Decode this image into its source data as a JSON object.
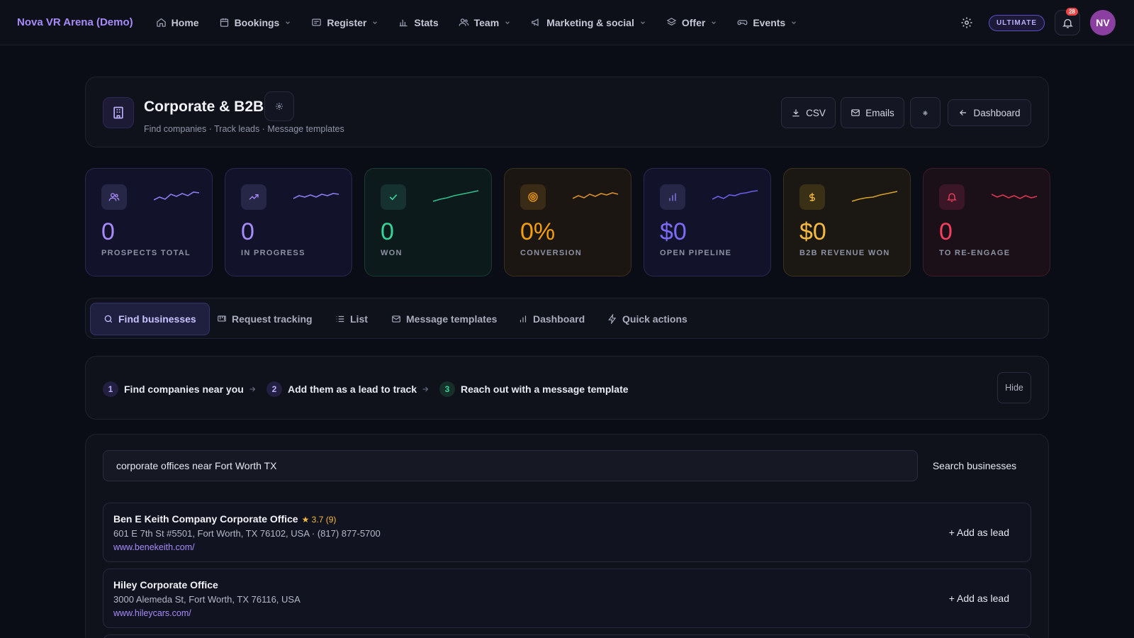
{
  "nav": {
    "brand": "Nova VR Arena (Demo)",
    "items": [
      {
        "label": "Home",
        "icon": "home-icon"
      },
      {
        "label": "Bookings",
        "icon": "calendar-icon"
      },
      {
        "label": "Register",
        "icon": "register-icon"
      },
      {
        "label": "Stats",
        "icon": "bar-chart-icon"
      },
      {
        "label": "Team",
        "icon": "users-icon"
      },
      {
        "label": "Marketing & social",
        "icon": "megaphone-icon"
      },
      {
        "label": "Offer",
        "icon": "layers-icon"
      },
      {
        "label": "Events",
        "icon": "gamepad-icon"
      }
    ],
    "plan_badge": "ULTIMATE",
    "notification_count": "28",
    "avatar_initials": "NV"
  },
  "header": {
    "title": "Corporate & B2B",
    "subtitle": "Find companies · Track leads · Message templates",
    "buttons": {
      "csv": "CSV",
      "emails": "Emails",
      "dashboard": "Dashboard"
    }
  },
  "stats": [
    {
      "value": "0",
      "label": "PROSPECTS TOTAL",
      "color": "#a78bfa"
    },
    {
      "value": "0",
      "label": "IN PROGRESS",
      "color": "#a78bfa"
    },
    {
      "value": "0",
      "label": "WON",
      "color": "#34d399"
    },
    {
      "value": "0%",
      "label": "CONVERSION",
      "color": "#f59e0b"
    },
    {
      "value": "$0",
      "label": "OPEN PIPELINE",
      "color": "#7c6cf5"
    },
    {
      "value": "$0",
      "label": "B2B REVENUE WON",
      "color": "#f5b940"
    },
    {
      "value": "0",
      "label": "TO RE-ENGAGE",
      "color": "#f43f5e"
    }
  ],
  "tabs": [
    {
      "label": "Find businesses"
    },
    {
      "label": "Request tracking"
    },
    {
      "label": "List"
    },
    {
      "label": "Message templates"
    },
    {
      "label": "Dashboard"
    },
    {
      "label": "Quick actions"
    }
  ],
  "steps": [
    {
      "num": "1",
      "label": "Find companies near you"
    },
    {
      "num": "2",
      "label": "Add them as a lead to track"
    },
    {
      "num": "3",
      "label": "Reach out with a message template"
    }
  ],
  "steps_hide": "Hide",
  "search": {
    "value": "corporate offices near Fort Worth TX",
    "button": "Search businesses"
  },
  "results": [
    {
      "name": "Ben E Keith Company Corporate Office",
      "rating": "★ 3.7 (9)",
      "address": "601 E 7th St #5501, Fort Worth, TX 76102, USA · (817) 877-5700",
      "url": "www.benekeith.com/",
      "action": "+ Add as lead"
    },
    {
      "name": "Hiley Corporate Office",
      "rating": "",
      "address": "3000 Alemeda St, Fort Worth, TX 76116, USA",
      "url": "www.hileycars.com/",
      "action": "+ Add as lead"
    }
  ]
}
